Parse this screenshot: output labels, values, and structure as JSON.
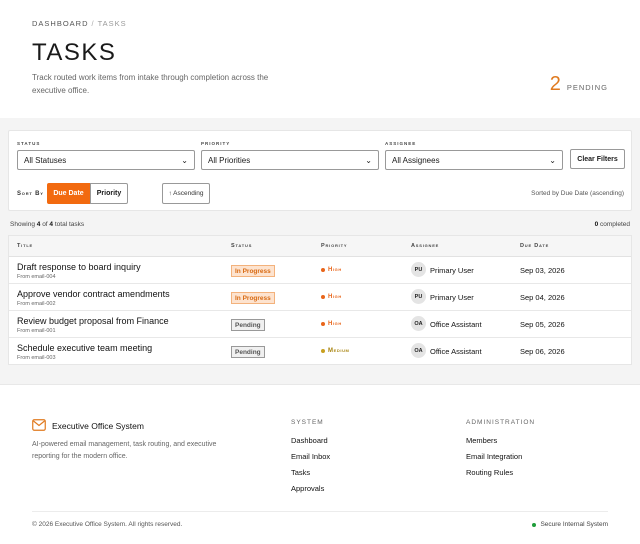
{
  "breadcrumb": {
    "root": "DASHBOARD",
    "separator": "/",
    "current": "TASKS"
  },
  "header": {
    "title": "TASKS",
    "subtitle": "Track routed work items from intake through completion across the executive office.",
    "pending_count": "2",
    "pending_label": "PENDING",
    "accent_color": "#e07a1f"
  },
  "filters": {
    "status": {
      "label": "STATUS",
      "value": "All Statuses"
    },
    "priority": {
      "label": "PRIORITY",
      "value": "All Priorities"
    },
    "assignee": {
      "label": "ASSIGNEE",
      "value": "All Assignees"
    },
    "clear_label": "Clear Filters",
    "sort_label": "Sort By",
    "sort_options": [
      "Due Date",
      "Priority"
    ],
    "sort_active": "Due Date",
    "direction_label": "↑ Ascending",
    "sorted_by_text": "Sorted by Due Date (ascending)",
    "active_color": "#f26a0f"
  },
  "summary": {
    "showing_prefix": "Showing",
    "shown": "4",
    "of_text": "of",
    "total": "4",
    "total_suffix": "total tasks",
    "completed_count": "0",
    "completed_label": "completed"
  },
  "table": {
    "columns": [
      "Title",
      "Status",
      "Priority",
      "Assignee",
      "Due Date"
    ],
    "rows": [
      {
        "title": "Draft response to board inquiry",
        "source": "From email-004",
        "status": "In Progress",
        "priority": "High",
        "initials": "PU",
        "assignee": "Primary User",
        "due": "Sep 03, 2026"
      },
      {
        "title": "Approve vendor contract amendments",
        "source": "From email-002",
        "status": "In Progress",
        "priority": "High",
        "initials": "PU",
        "assignee": "Primary User",
        "due": "Sep 04, 2026"
      },
      {
        "title": "Review budget proposal from Finance",
        "source": "From email-001",
        "status": "Pending",
        "priority": "High",
        "initials": "OA",
        "assignee": "Office Assistant",
        "due": "Sep 05, 2026"
      },
      {
        "title": "Schedule executive team meeting",
        "source": "From email-003",
        "status": "Pending",
        "priority": "Medium",
        "initials": "OA",
        "assignee": "Office Assistant",
        "due": "Sep 06, 2026"
      }
    ],
    "priority_colors": {
      "High": "#e8651a",
      "Medium": "#c8a020"
    }
  },
  "footer": {
    "brand_name": "Executive Office System",
    "brand_icon": "mail-icon",
    "description": "AI-powered email management, task routing, and executive reporting for the modern office.",
    "system": {
      "heading": "SYSTEM",
      "links": [
        "Dashboard",
        "Email Inbox",
        "Tasks",
        "Approvals"
      ]
    },
    "admin": {
      "heading": "ADMINISTRATION",
      "links": [
        "Members",
        "Email Integration",
        "Routing Rules"
      ]
    },
    "copyright": "© 2026 Executive Office System. All rights reserved.",
    "secure_label": "Secure Internal System"
  }
}
